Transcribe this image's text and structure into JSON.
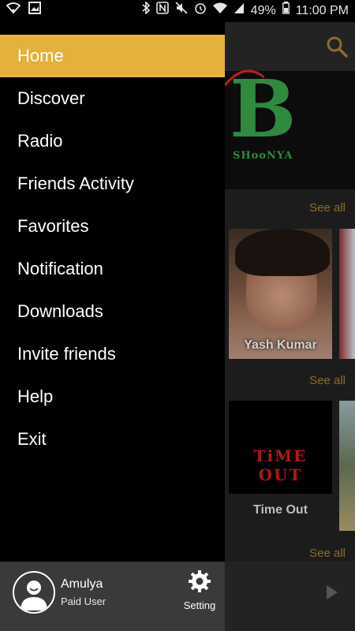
{
  "status_bar": {
    "battery": "49%",
    "time": "11:00 PM",
    "left_icons": [
      "wifi-icon",
      "image-icon"
    ],
    "right_icons": [
      "bluetooth-icon",
      "nfc-icon",
      "mute-icon",
      "alarm-icon",
      "wifi-icon",
      "signal-icon",
      "battery-icon"
    ]
  },
  "drawer": {
    "menu": [
      {
        "label": "Home",
        "active": true
      },
      {
        "label": "Discover"
      },
      {
        "label": "Radio"
      },
      {
        "label": "Friends Activity"
      },
      {
        "label": "Favorites"
      },
      {
        "label": "Notification"
      },
      {
        "label": "Downloads"
      },
      {
        "label": "Invite friends"
      },
      {
        "label": "Help"
      },
      {
        "label": "Exit"
      }
    ],
    "footer": {
      "user_name": "Amulya",
      "user_plan": "Paid User",
      "setting_label": "Setting"
    }
  },
  "background_app": {
    "banner_text": "SHooNYA",
    "see_all": [
      "See all",
      "See all",
      "See all"
    ],
    "cards": [
      {
        "label": "Yash Kumar"
      },
      {
        "label": "Time Out",
        "art_text": "TiME OUT"
      }
    ]
  },
  "colors": {
    "accent": "#e5b13a",
    "see_all": "#8c6b2a",
    "footer_bg": "#3a3a3a"
  }
}
